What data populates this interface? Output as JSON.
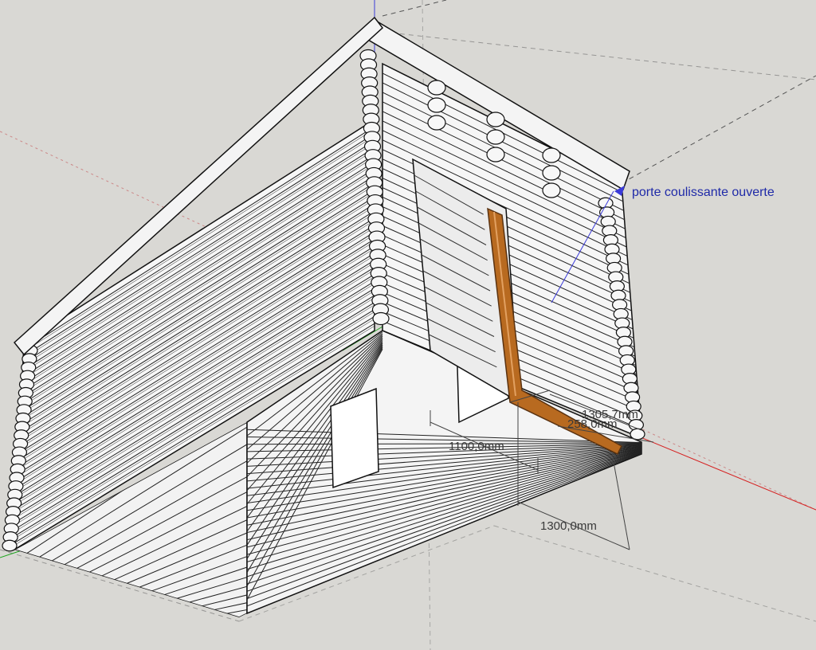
{
  "view": {
    "background": "#d9d8d4",
    "wall_face_color": "#f7f7f7",
    "wall_shade_color": "#e9e9e9",
    "edge_color": "#111111",
    "door_color": "#b86a20",
    "axis_red": "#d62020",
    "axis_green": "#1fa61f",
    "axis_blue": "#3b3bd9",
    "guide_color": "#555555"
  },
  "annotations": {
    "door_label": "porte coulissante ouverte",
    "dim_width": "1100,0mm",
    "dim_depth": "1300,0mm",
    "dim_top_a": "1305,7mm",
    "dim_top_b": "258,0mm"
  }
}
